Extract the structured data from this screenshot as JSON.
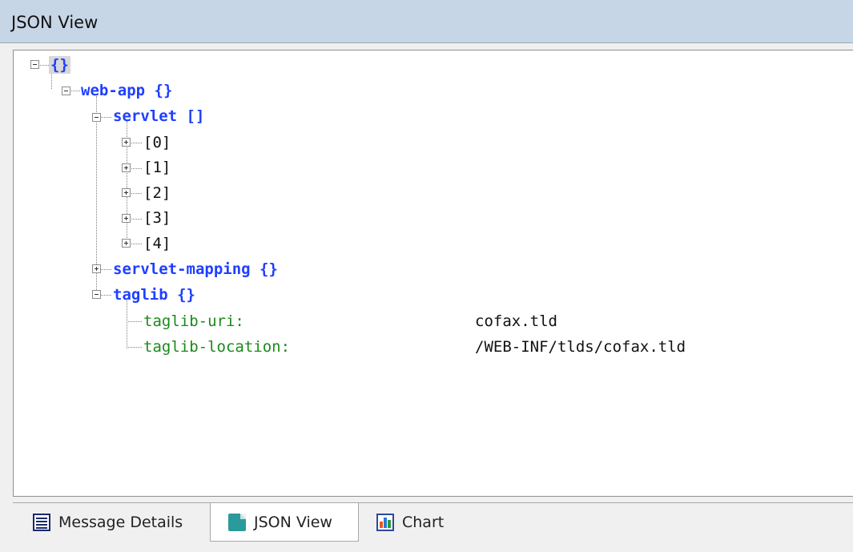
{
  "panel": {
    "title": "JSON View"
  },
  "tree": {
    "root": "{}",
    "web_app": "web-app {}",
    "servlet": "servlet []",
    "servlet_items": [
      "[0]",
      "[1]",
      "[2]",
      "[3]",
      "[4]"
    ],
    "servlet_mapping": "servlet-mapping {}",
    "taglib": "taglib {}",
    "taglib_uri_key": "taglib-uri:",
    "taglib_uri_value": "cofax.tld",
    "taglib_location_key": "taglib-location:",
    "taglib_location_value": "/WEB-INF/tlds/cofax.tld"
  },
  "tabs": [
    {
      "label": "Message Details",
      "icon": "message-details-icon",
      "active": false
    },
    {
      "label": "JSON View",
      "icon": "json-file-icon",
      "active": true
    },
    {
      "label": "Chart",
      "icon": "chart-icon",
      "active": false
    }
  ]
}
